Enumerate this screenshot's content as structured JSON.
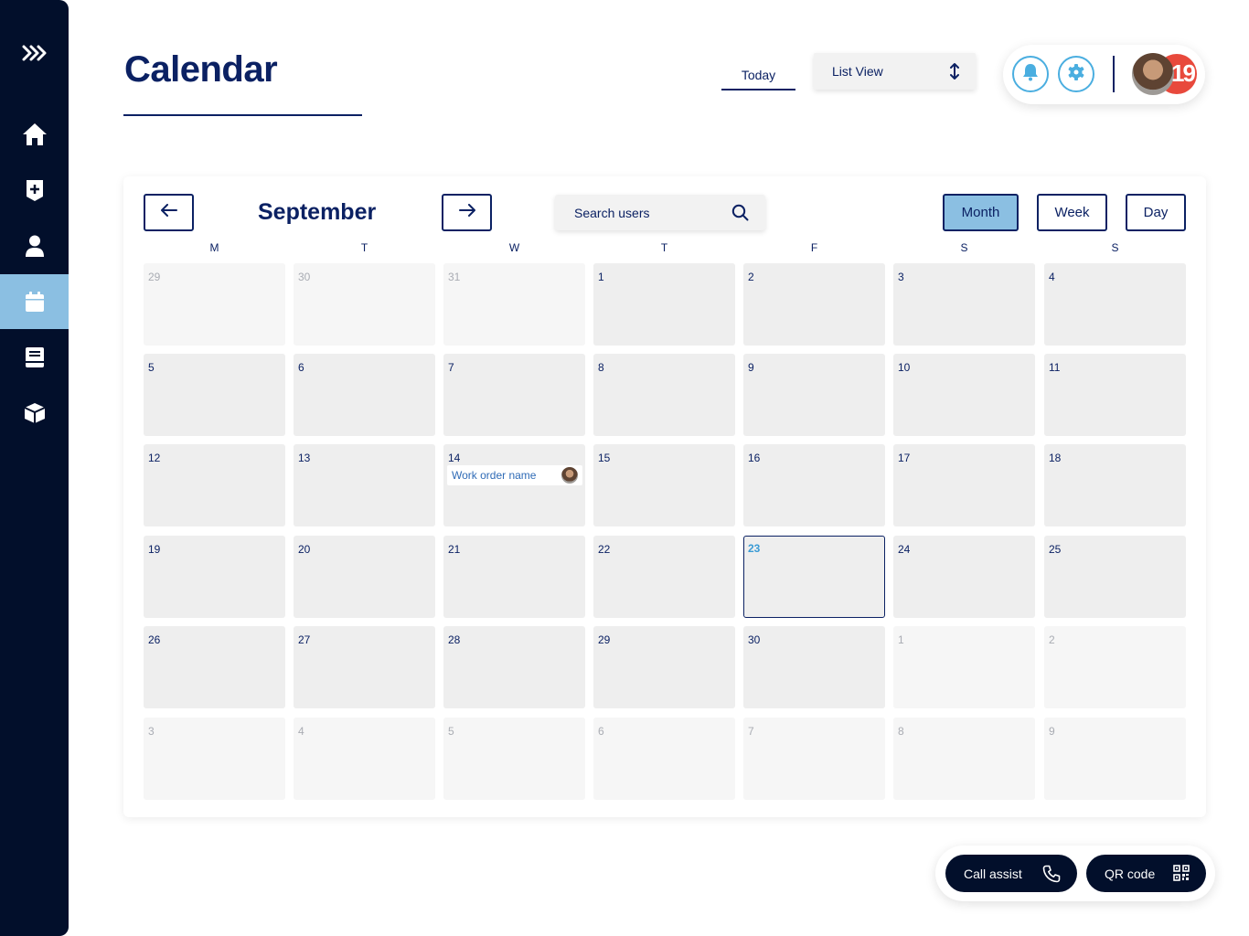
{
  "sidebar": {
    "items": [
      {
        "icon": "chevrons-right-icon"
      },
      {
        "icon": "home-icon"
      },
      {
        "icon": "medical-plus-icon"
      },
      {
        "icon": "user-icon"
      },
      {
        "icon": "calendar-icon",
        "active": true
      },
      {
        "icon": "book-icon"
      },
      {
        "icon": "box-icon"
      }
    ]
  },
  "header": {
    "title": "Calendar",
    "today_label": "Today",
    "view_select": {
      "selected": "List View"
    },
    "notification_count": "19"
  },
  "calendar": {
    "month": "September",
    "search_placeholder": "Search users",
    "view_buttons": [
      {
        "label": "Month",
        "active": true
      },
      {
        "label": "Week",
        "active": false
      },
      {
        "label": "Day",
        "active": false
      }
    ],
    "weekdays": [
      "M",
      "T",
      "W",
      "T",
      "F",
      "S",
      "S"
    ],
    "weeks": [
      [
        {
          "d": "29",
          "o": true
        },
        {
          "d": "30",
          "o": true
        },
        {
          "d": "31",
          "o": true
        },
        {
          "d": "1"
        },
        {
          "d": "2"
        },
        {
          "d": "3"
        },
        {
          "d": "4"
        }
      ],
      [
        {
          "d": "5"
        },
        {
          "d": "6"
        },
        {
          "d": "7"
        },
        {
          "d": "8"
        },
        {
          "d": "9"
        },
        {
          "d": "10"
        },
        {
          "d": "11"
        }
      ],
      [
        {
          "d": "12"
        },
        {
          "d": "13"
        },
        {
          "d": "14",
          "event": "Work order name"
        },
        {
          "d": "15"
        },
        {
          "d": "16"
        },
        {
          "d": "17"
        },
        {
          "d": "18"
        }
      ],
      [
        {
          "d": "19"
        },
        {
          "d": "20"
        },
        {
          "d": "21"
        },
        {
          "d": "22"
        },
        {
          "d": "23",
          "today": true
        },
        {
          "d": "24"
        },
        {
          "d": "25"
        }
      ],
      [
        {
          "d": "26"
        },
        {
          "d": "27"
        },
        {
          "d": "28"
        },
        {
          "d": "29"
        },
        {
          "d": "30"
        },
        {
          "d": "1",
          "o": true
        },
        {
          "d": "2",
          "o": true
        }
      ],
      [
        {
          "d": "3",
          "o": true
        },
        {
          "d": "4",
          "o": true
        },
        {
          "d": "5",
          "o": true
        },
        {
          "d": "6",
          "o": true
        },
        {
          "d": "7",
          "o": true
        },
        {
          "d": "8",
          "o": true
        },
        {
          "d": "9",
          "o": true
        }
      ]
    ]
  },
  "bottom_actions": {
    "call_assist_label": "Call assist",
    "qr_code_label": "QR code"
  },
  "colors": {
    "navy": "#0b2163",
    "sidebar_bg": "#020f2b",
    "accent_light_blue": "#8bbfe2",
    "icon_blue": "#4aaee0",
    "badge_red": "#e8493c",
    "cell_bg": "#eeeeee"
  }
}
